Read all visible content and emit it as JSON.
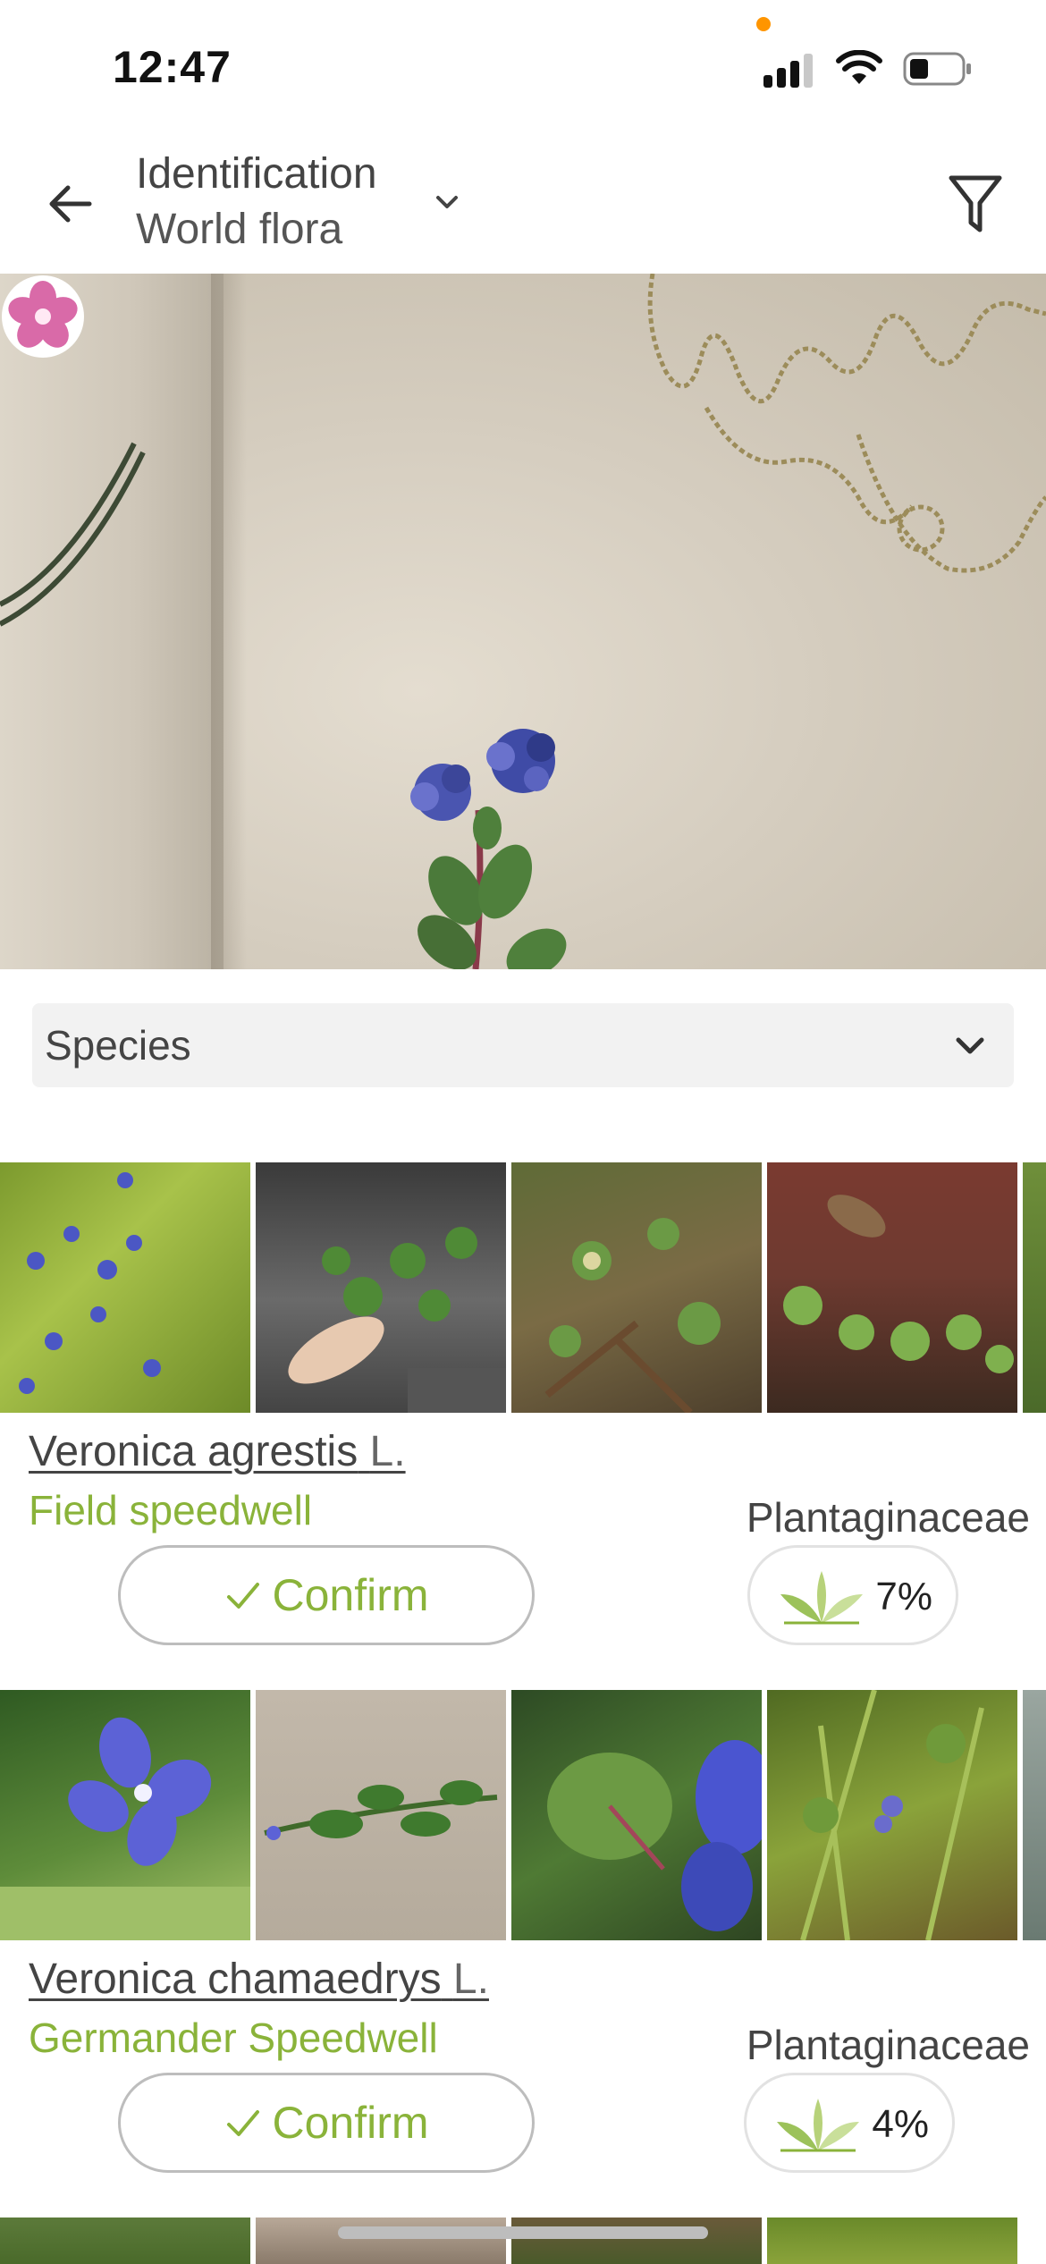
{
  "status_bar": {
    "time": "12:47",
    "indicator_color": "#ff9500"
  },
  "header": {
    "title": "Identification",
    "subtitle": "World flora",
    "back_icon": "arrow-left-icon",
    "dropdown_icon": "chevron-down-icon",
    "filter_icon": "filter-icon"
  },
  "hero": {
    "description_badge_icon": "plantnet-flower-icon"
  },
  "group_selector": {
    "selected": "Species",
    "icon": "chevron-down-icon"
  },
  "colors": {
    "accent_green": "#8ab33a",
    "text": "#444444",
    "border": "#bdbdbd"
  },
  "results": [
    {
      "scientific_name": "Veronica agrestis",
      "author": "L.",
      "common_name": "Field speedwell",
      "family": "Plantaginaceae",
      "confirm_label": "Confirm",
      "score": "7%"
    },
    {
      "scientific_name": "Veronica chamaedrys",
      "author": "L.",
      "common_name": "Germander Speedwell",
      "family": "Plantaginaceae",
      "confirm_label": "Confirm",
      "score": "4%"
    }
  ]
}
